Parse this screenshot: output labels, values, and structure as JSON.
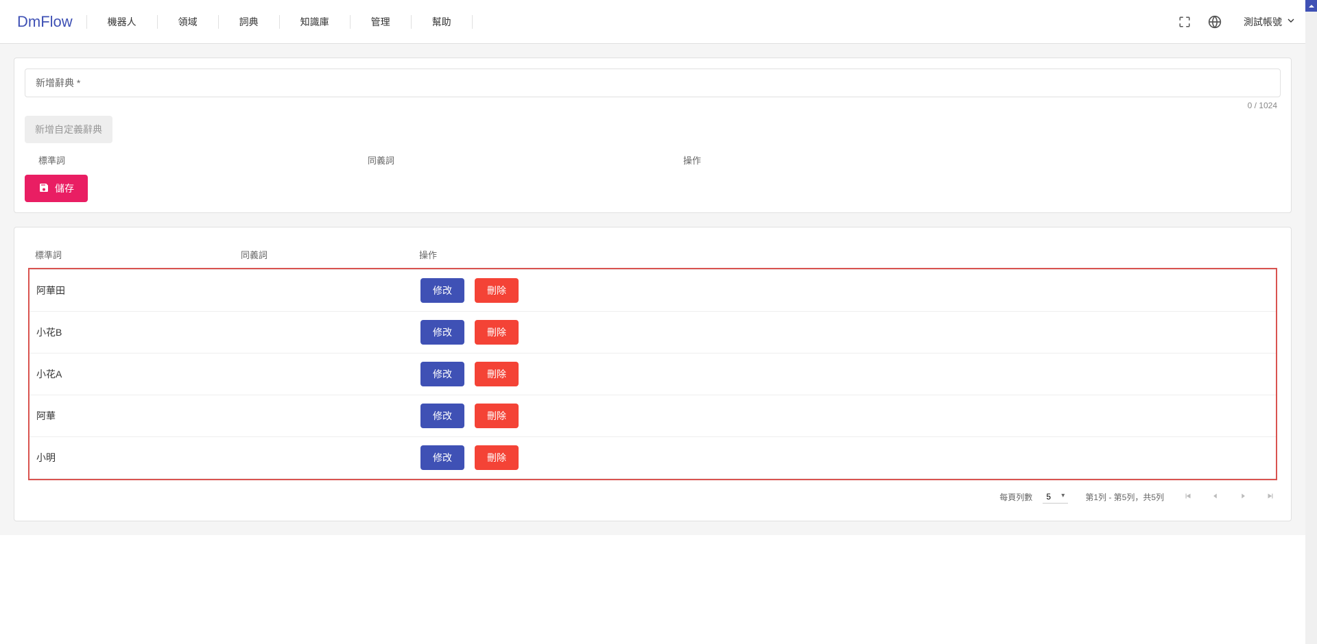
{
  "header": {
    "logo": "DmFlow",
    "nav": [
      "機器人",
      "領域",
      "詞典",
      "知識庫",
      "管理",
      "幫助"
    ],
    "account": "測試帳號"
  },
  "form": {
    "input_placeholder": "新增辭典 *",
    "char_count": "0 / 1024",
    "add_custom_btn": "新增自定義辭典",
    "table_headers": [
      "標準詞",
      "同義詞",
      "操作"
    ],
    "save_btn": "儲存"
  },
  "table": {
    "headers": [
      "標準詞",
      "同義詞",
      "操作"
    ],
    "edit_label": "修改",
    "delete_label": "刪除",
    "rows": [
      {
        "standard": "阿華田",
        "synonym": ""
      },
      {
        "standard": "小花B",
        "synonym": ""
      },
      {
        "standard": "小花A",
        "synonym": ""
      },
      {
        "standard": "阿華",
        "synonym": ""
      },
      {
        "standard": "小明",
        "synonym": ""
      }
    ]
  },
  "pagination": {
    "per_page_label": "每頁列數",
    "per_page_value": "5",
    "range_label": "第1列 - 第5列，共5列"
  }
}
